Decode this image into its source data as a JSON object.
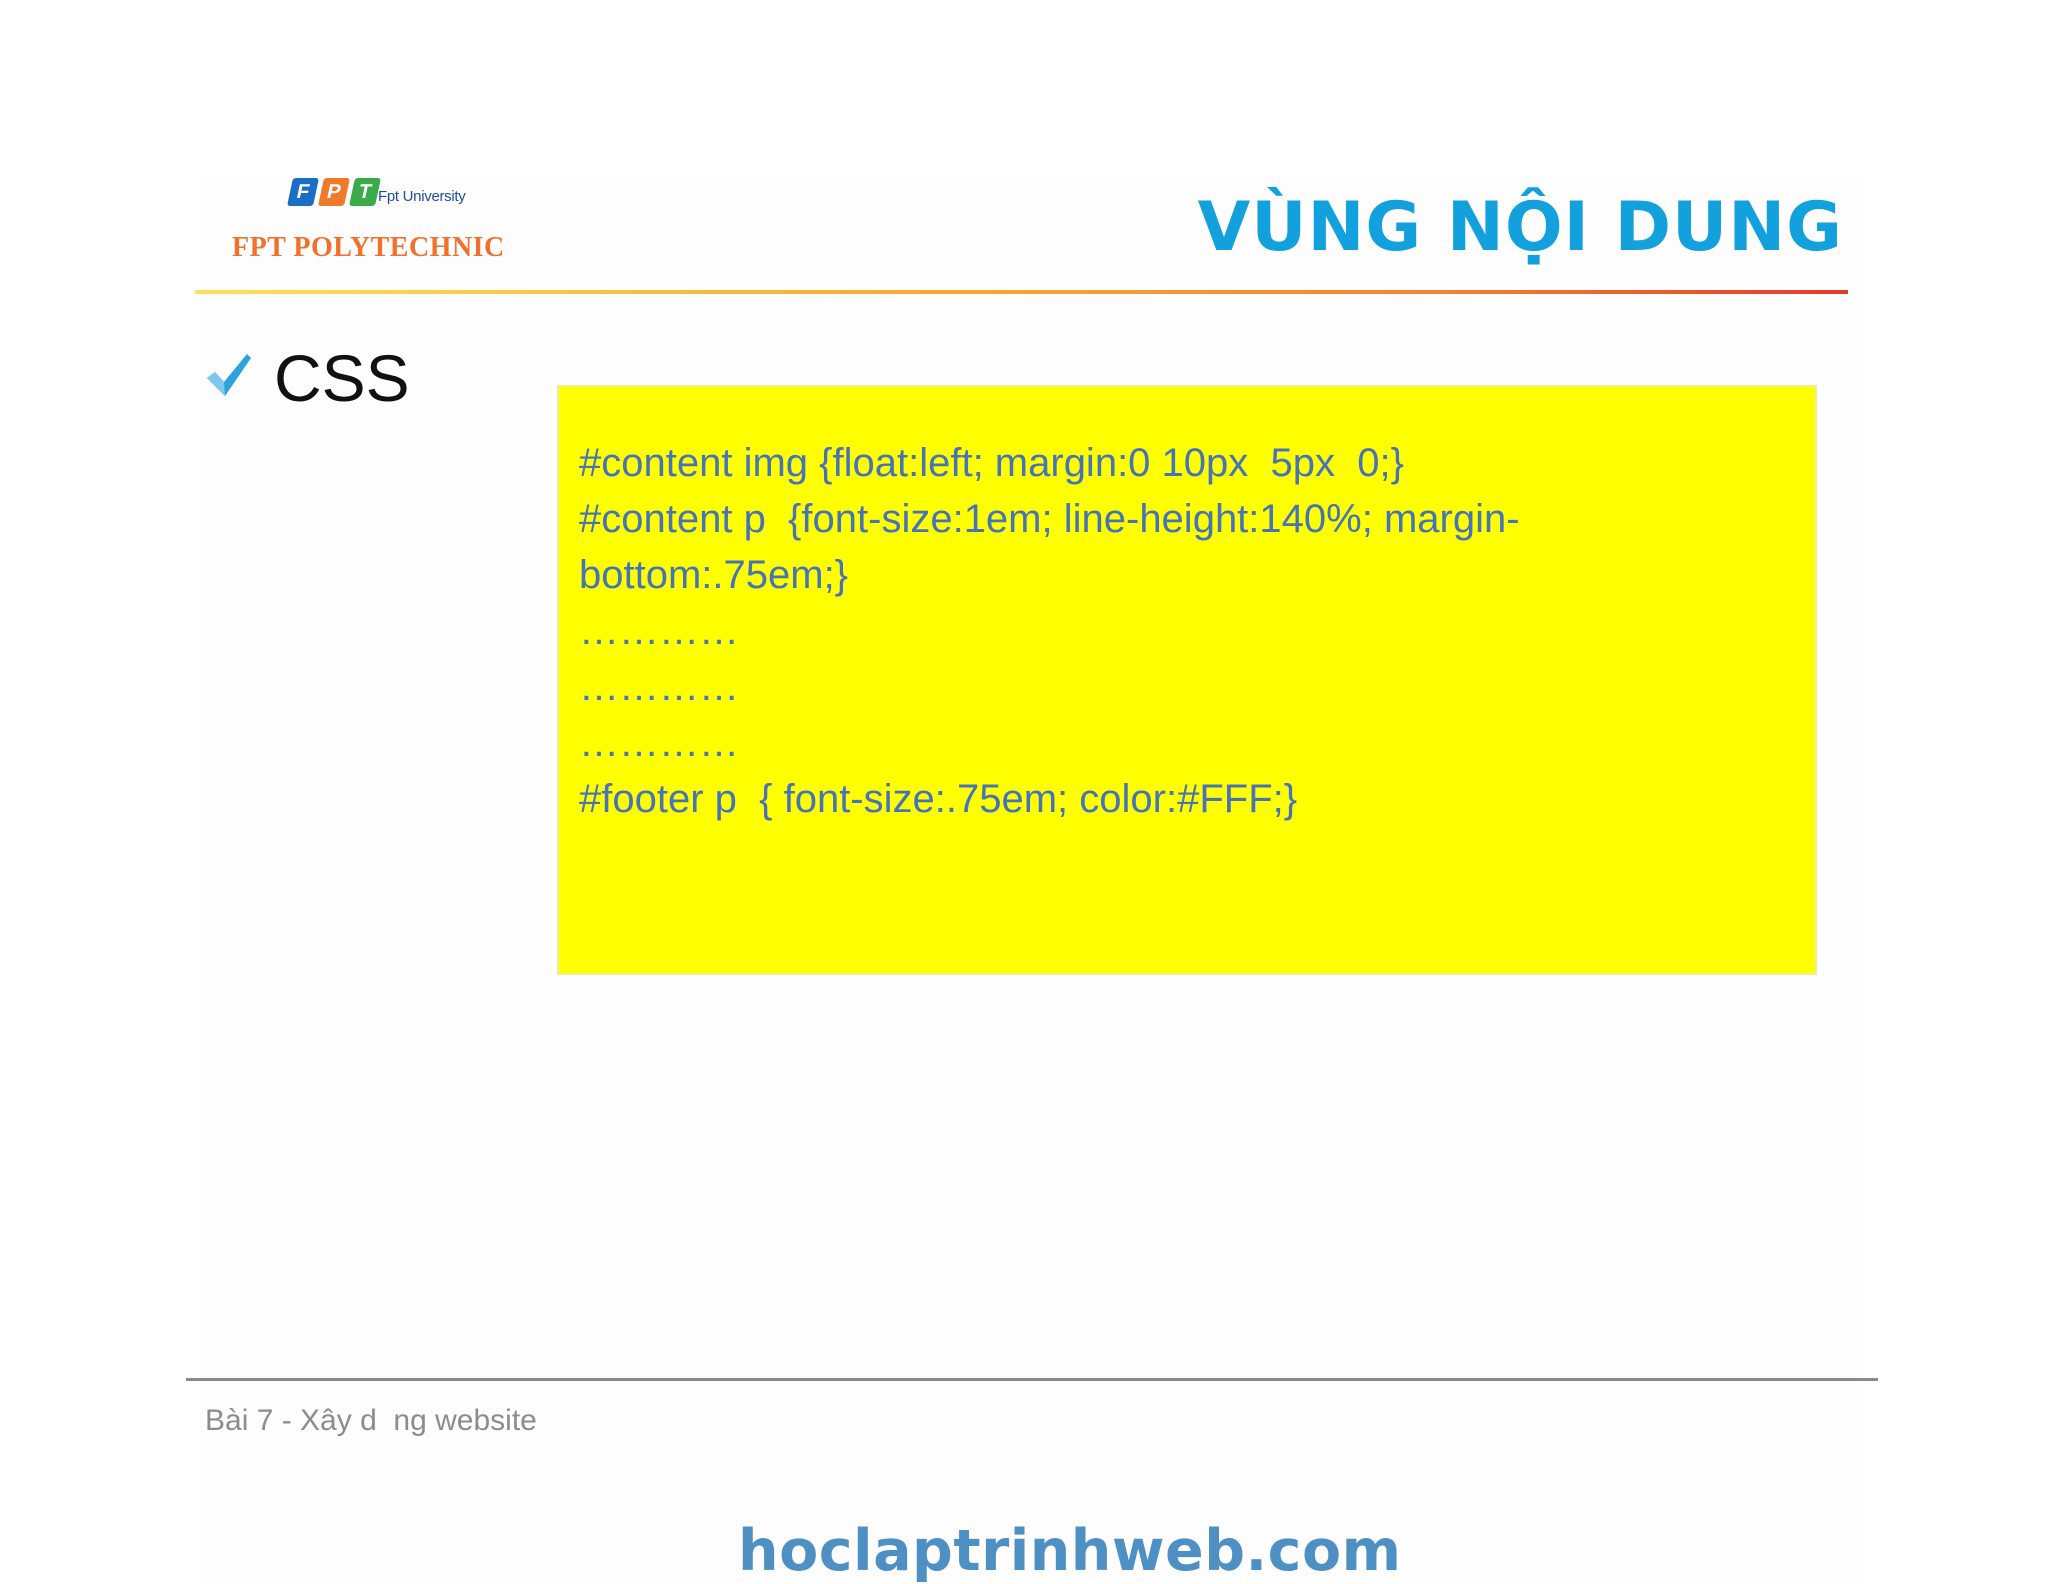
{
  "header": {
    "logo": {
      "badges": [
        {
          "letter": "F",
          "color": "#1a6fc4"
        },
        {
          "letter": "P",
          "color": "#f07a2b"
        },
        {
          "letter": "T",
          "color": "#3bab4a"
        }
      ],
      "university": "Fpt University",
      "name": "FPT POLYTECHNIC"
    },
    "title": "VÙNG NỘI DUNG"
  },
  "bullet": {
    "icon": "check-icon",
    "label": "CSS"
  },
  "code_box": {
    "background": "#ffff00",
    "lines": [
      "#content img {float:left; margin:0 10px  5px  0;}",
      "#content p  {font-size:1em; line-height:140%; margin-",
      "bottom:.75em;}",
      "…………",
      "…………",
      "…………",
      "#footer p  { font-size:.75em; color:#FFF;}"
    ]
  },
  "footer": {
    "text": "Bài 7 - Xây d  ng website"
  },
  "watermark": "hoclaptrinhweb.com"
}
